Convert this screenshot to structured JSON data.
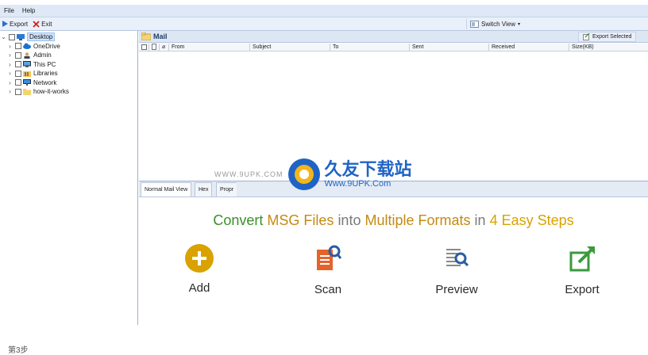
{
  "menu": {
    "file": "File",
    "help": "Help"
  },
  "toolbar": {
    "export": "Export",
    "exit": "Exit",
    "switch_view": "Switch View"
  },
  "tree": [
    {
      "label": "Desktop",
      "expander": "⌄",
      "icon": "desktop-icon",
      "selected": true
    },
    {
      "label": "OneDrive",
      "expander": "›",
      "icon": "cloud-icon"
    },
    {
      "label": "Admin",
      "expander": "›",
      "icon": "user-icon"
    },
    {
      "label": "This PC",
      "expander": "›",
      "icon": "monitor-icon"
    },
    {
      "label": "Libraries",
      "expander": "›",
      "icon": "library-icon"
    },
    {
      "label": "Network",
      "expander": "›",
      "icon": "network-icon"
    },
    {
      "label": "how-it-works",
      "expander": "›",
      "icon": "folder-icon"
    }
  ],
  "mail": {
    "title": "Mail",
    "export_selected": "Export Selected",
    "columns": [
      "From",
      "Subject",
      "To",
      "Sent",
      "Received",
      "Size(KB)"
    ]
  },
  "tabs": [
    "Normal Mail View",
    "Hex",
    "Propr"
  ],
  "headline": {
    "part1": "Convert",
    "part2": "MSG Files",
    "part3": "into",
    "part4": "Multiple Formats",
    "part5": "in",
    "part6": "4 Easy Steps"
  },
  "steps": [
    {
      "label": "Add",
      "icon": "add-icon"
    },
    {
      "label": "Scan",
      "icon": "scan-icon"
    },
    {
      "label": "Preview",
      "icon": "preview-icon"
    },
    {
      "label": "Export",
      "icon": "export-icon"
    }
  ],
  "watermark": {
    "logo_text": "久友下载站",
    "url": "Www.9UPK.Com",
    "site": "WWW.9UPK.COM"
  },
  "caption": "第3步",
  "colors": {
    "green": "#3b8f2a",
    "orange": "#c38a12",
    "gray": "#7a7a7a",
    "accent_yellow": "#d9a200"
  }
}
